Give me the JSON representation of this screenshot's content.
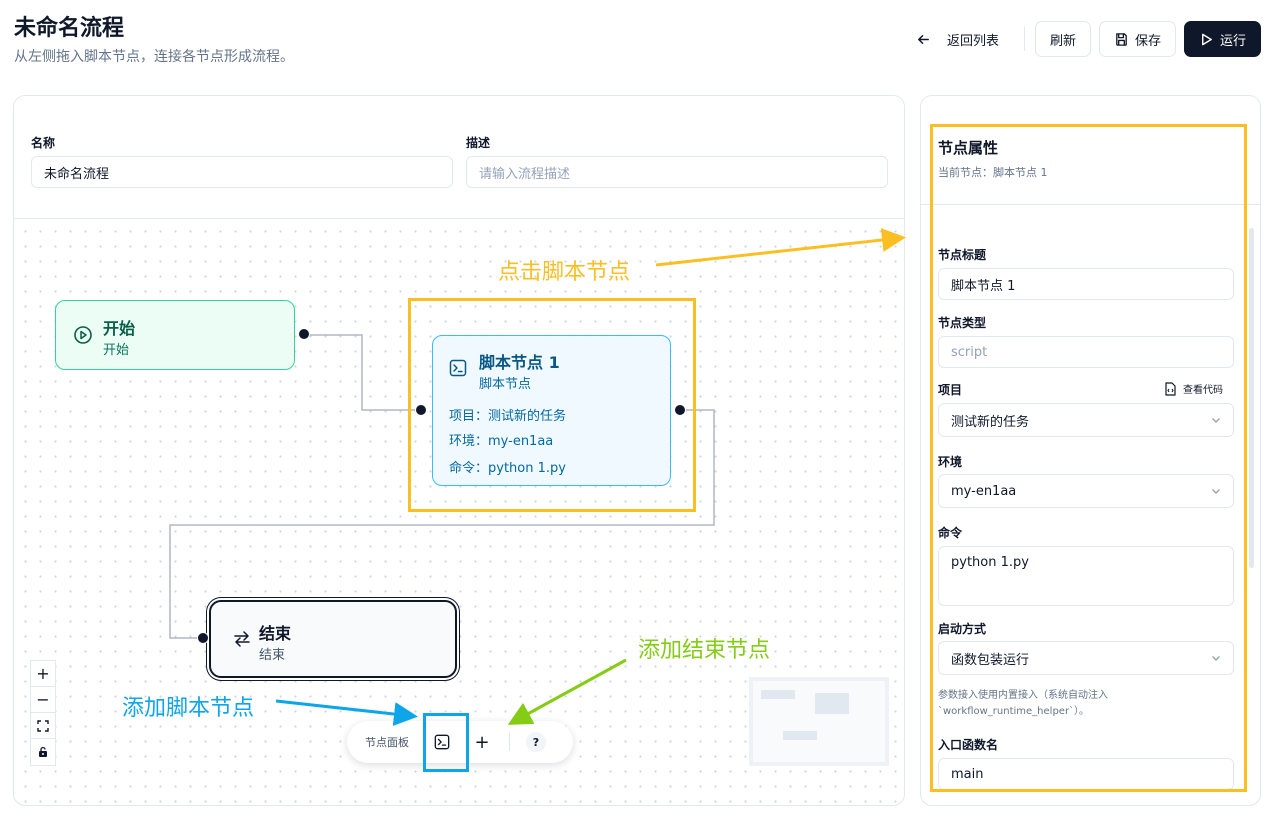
{
  "header": {
    "title": "未命名流程",
    "subtitle": "从左侧拖入脚本节点，连接各节点形成流程。",
    "back_label": "返回列表",
    "refresh_label": "刷新",
    "save_label": "保存",
    "run_label": "运行"
  },
  "form": {
    "name_label": "名称",
    "name_value": "未命名流程",
    "desc_label": "描述",
    "desc_placeholder": "请输入流程描述"
  },
  "nodes": {
    "start": {
      "title": "开始",
      "subtitle": "开始"
    },
    "script": {
      "title": "脚本节点 1",
      "subtitle": "脚本节点",
      "project": "项目：测试新的任务",
      "env": "环境：my-en1aa",
      "command": "命令：python 1.py"
    },
    "end": {
      "title": "结束",
      "subtitle": "结束"
    }
  },
  "zoom_controls": {
    "zoom_in": "+",
    "zoom_out": "−"
  },
  "palette": {
    "label": "节点面板",
    "add_symbol": "+",
    "help_symbol": "?"
  },
  "properties": {
    "title": "节点属性",
    "current_node": "当前节点：脚本节点 1",
    "node_title_label": "节点标题",
    "node_title_value": "脚本节点 1",
    "node_type_label": "节点类型",
    "node_type_value": "script",
    "project_label": "项目",
    "view_code_label": "查看代码",
    "project_value": "测试新的任务",
    "env_label": "环境",
    "env_value": "my-en1aa",
    "command_label": "命令",
    "command_value": "python 1.py",
    "start_mode_label": "启动方式",
    "start_mode_value": "函数包装运行",
    "start_mode_note_1": "参数接入使用内置接入（系统自动注入",
    "start_mode_note_2": "`workflow_runtime_helper`）。",
    "entry_label": "入口函数名",
    "entry_value": "main"
  },
  "annotations": {
    "click_script": "点击脚本节点",
    "add_script": "添加脚本节点",
    "add_end": "添加结束节点",
    "yellow": "#fbbf24",
    "blue": "#0ea5e9",
    "green": "#84cc16"
  }
}
